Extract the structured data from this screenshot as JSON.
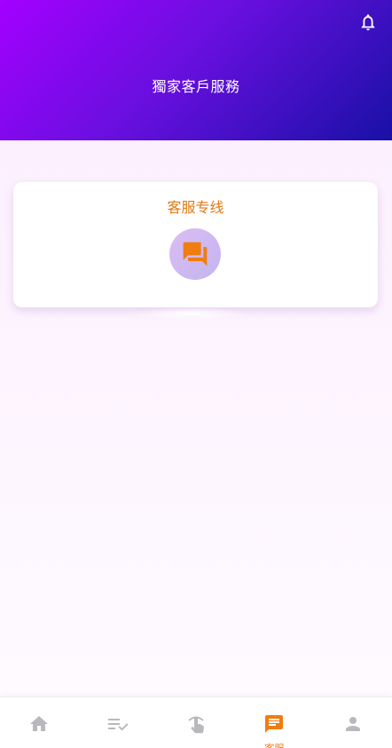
{
  "header": {
    "title": "獨家客戶服務",
    "bell_icon": "bell-icon"
  },
  "card": {
    "title": "客服专线",
    "icon": "chat-icon"
  },
  "tabbar": {
    "items": [
      {
        "icon": "home-icon",
        "label": "",
        "active": false
      },
      {
        "icon": "list-check-icon",
        "label": "",
        "active": false
      },
      {
        "icon": "tap-icon",
        "label": "",
        "active": false
      },
      {
        "icon": "message-icon",
        "label": "客服",
        "active": true
      },
      {
        "icon": "person-icon",
        "label": "",
        "active": false
      }
    ]
  },
  "colors": {
    "accent": "#f07d10",
    "inactive_icon": "#b9b9bd",
    "header_start": "#a300ff",
    "header_end": "#1810a6"
  }
}
